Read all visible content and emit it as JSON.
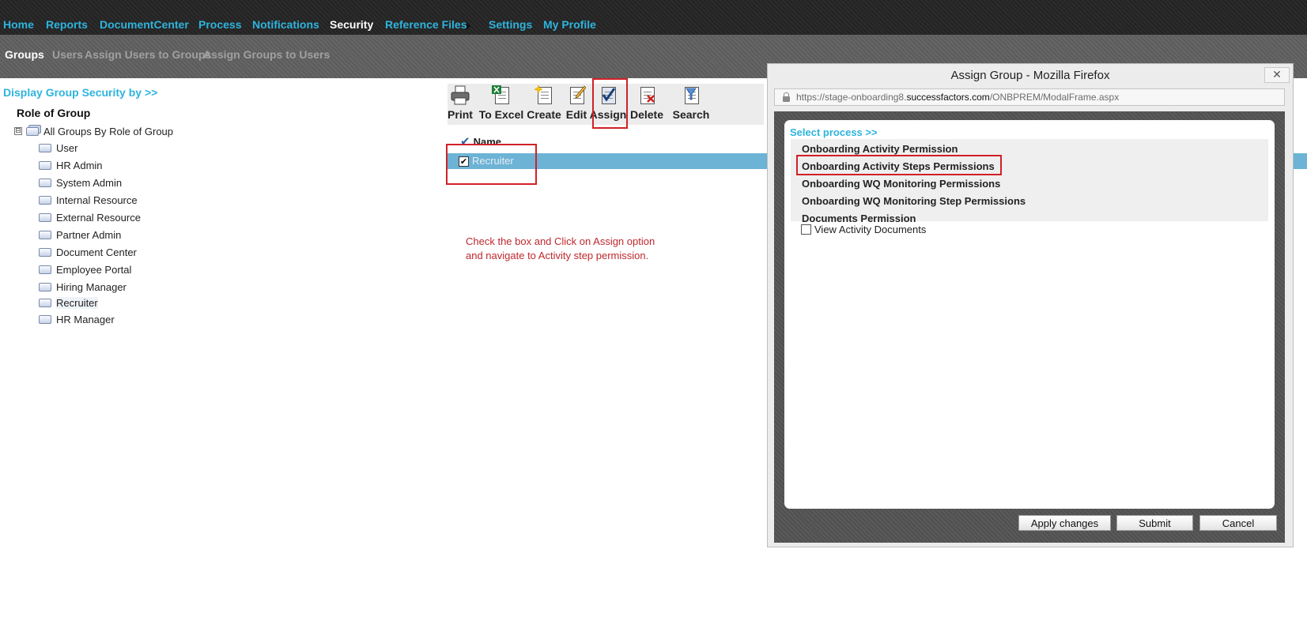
{
  "topnav": {
    "items": [
      "Home",
      "Reports",
      "DocumentCenter",
      "Process",
      "Notifications",
      "Security",
      "Reference Files",
      "Settings",
      "My Profile"
    ],
    "active": "Security"
  },
  "subnav": {
    "items": [
      "Groups",
      "Users",
      "Assign Users to Groups",
      "Assign Groups to Users"
    ],
    "active": "Groups"
  },
  "left_panel": {
    "display_by": "Display Group Security by >>",
    "heading": "Role of Group",
    "root": "All Groups By Role of Group",
    "expander": "⊟",
    "groups": [
      "User",
      "HR Admin",
      "System Admin",
      "Internal Resource",
      "External Resource",
      "Partner Admin",
      "Document Center",
      "Employee Portal",
      "Hiring Manager",
      "Recruiter",
      "HR Manager"
    ]
  },
  "toolbar": {
    "buttons": [
      "Print",
      "To Excel",
      "Create",
      "Edit",
      "Assign",
      "Delete",
      "Search"
    ]
  },
  "grid": {
    "header": "Name",
    "header_icon": "✔",
    "row_checked_glyph": "✔",
    "rows": [
      {
        "name": "Recruiter",
        "checked": true
      }
    ]
  },
  "annotation": {
    "line1": "Check the box and Click on Assign option",
    "line2": "and navigate to Activity step permission."
  },
  "modal": {
    "title": "Assign Group - Mozilla Firefox",
    "close_glyph": "✕",
    "url": {
      "prefix": "https://stage-onboarding8.",
      "domain": "successfactors.com",
      "path": "/ONBPREM/ModalFrame.aspx"
    },
    "select_title": "Select process >>",
    "processes": [
      "Onboarding Activity Permission",
      "Onboarding Activity Steps Permissions",
      "Onboarding WQ Monitoring Permissions",
      "Onboarding WQ Monitoring Step Permissions",
      "Documents Permission"
    ],
    "permission_option": {
      "label": "View Activity Documents",
      "checked": false
    },
    "buttons": {
      "apply": "Apply changes",
      "submit": "Submit",
      "cancel": "Cancel"
    }
  },
  "colors": {
    "nav_link": "#2eb4dd",
    "highlight_red": "#d02127",
    "row_selected": "#6cb3d6",
    "annotation_red": "#c0282d"
  }
}
